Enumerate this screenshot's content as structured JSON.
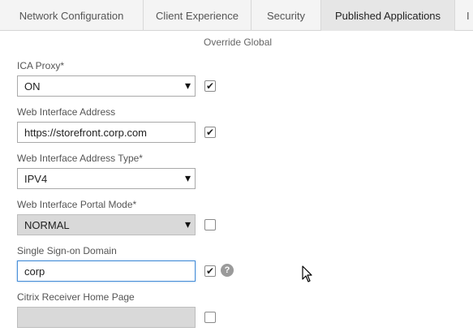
{
  "tabs": [
    {
      "label": "Network Configuration",
      "active": false
    },
    {
      "label": "Client Experience",
      "active": false
    },
    {
      "label": "Security",
      "active": false
    },
    {
      "label": "Published Applications",
      "active": true
    },
    {
      "label": "I",
      "active": false
    }
  ],
  "override_header": "Override Global",
  "fields": {
    "ica_proxy": {
      "label": "ICA Proxy*",
      "value": "ON",
      "override": true
    },
    "web_interface_address": {
      "label": "Web Interface Address",
      "value": "https://storefront.corp.com",
      "override": true
    },
    "web_interface_address_type": {
      "label": "Web Interface Address Type*",
      "value": "IPV4"
    },
    "web_interface_portal_mode": {
      "label": "Web Interface Portal Mode*",
      "value": "NORMAL",
      "override": false,
      "disabled": true
    },
    "single_sign_on_domain": {
      "label": "Single Sign-on Domain",
      "value": "corp",
      "override": true
    },
    "citrix_receiver_home_page": {
      "label": "Citrix Receiver Home Page",
      "value": "",
      "override": false,
      "disabled": true
    }
  },
  "icons": {
    "checkmark": "✔",
    "help": "?"
  },
  "colors": {
    "focus_border": "#4a90d9",
    "disabled_fill": "#d9d9d9",
    "help_icon": "#9a9a9a"
  }
}
